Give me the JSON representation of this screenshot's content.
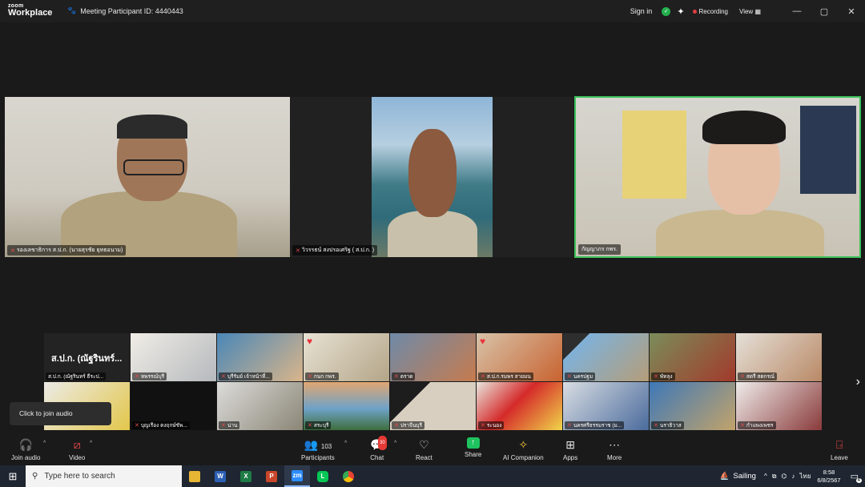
{
  "titlebar": {
    "brand_top": "zoom",
    "brand_bottom": "Workplace",
    "meeting_id": "Meeting Participant ID: 4440443",
    "sign_in": "Sign in",
    "recording": "Recording",
    "view": "View",
    "minimize": "—",
    "maximize": "▢",
    "close": "✕"
  },
  "main_videos": [
    {
      "name": "รองเลขาธิการ ส.ป.ก. (นายสุรชัย ยุทธอนาม)"
    },
    {
      "name": "วิวรรธน์ สงปรอเศริฐ ( ส.ป.ก. )"
    },
    {
      "name": "กัญญาภร กพร."
    }
  ],
  "gallery": {
    "first_title": "ส.ป.ก. (ณัฐรินทร์...",
    "first_name": "ส.ป.ก. (ณัฐรินทร์ ธีระป...",
    "row1": [
      "หพรรณ์บุรี",
      "บุรีรัมย์ เจ้าหน้าที่...",
      "กนก กพร.",
      "ตราด",
      "ส.ป.ก.รมพร สายมน",
      "นครปฐม",
      "พัทลุง",
      "สตรี สตกรณ์"
    ],
    "row2": [
      "",
      "บุญเรือง ตงฤกษ์ชัพ...",
      "น่าน",
      "สระบุรี",
      "ปราจีนบุรี",
      "ระนอง",
      "นครศรีธรรมราช (ม...",
      "นราธิวาส",
      "กำแพงเพชร"
    ]
  },
  "tooltip": "Click to join audio",
  "toolbar": {
    "join_audio": "Join audio",
    "video": "Video",
    "participants": "Participants",
    "participants_count": "103",
    "chat": "Chat",
    "chat_badge": "30",
    "react": "React",
    "share": "Share",
    "ai_companion": "AI Companion",
    "apps": "Apps",
    "more": "More",
    "leave": "Leave"
  },
  "taskbar": {
    "search_placeholder": "Type here to search",
    "weather": "Sailing",
    "lang": "ไทย",
    "time": "8:58",
    "date": "6/8/2567",
    "notification_count": "4"
  },
  "colors": {
    "accent_green": "#3cc15a",
    "record_red": "#e23d3d",
    "share_green": "#1fc35f"
  }
}
